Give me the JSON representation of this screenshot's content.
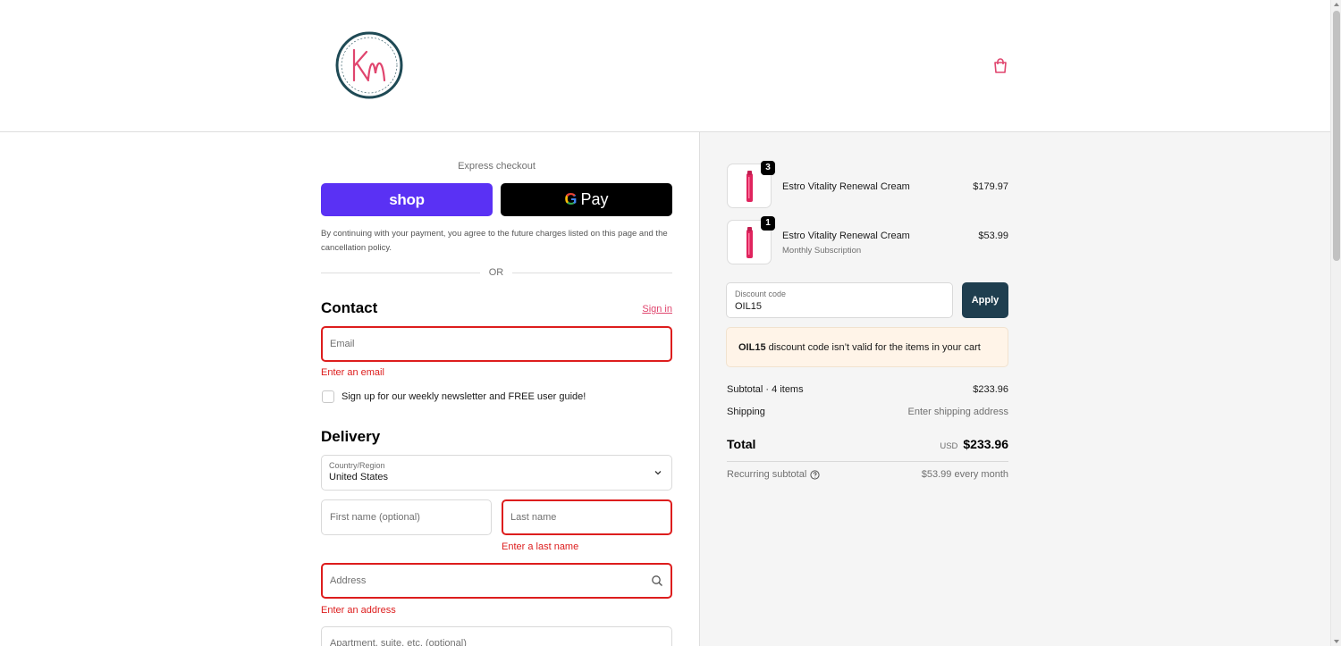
{
  "header": {
    "logo_text": "KM",
    "logo_ring_text": "KAREN MARTEL · HORMONE SOLUTIONS",
    "cart_icon": "shopping-bag-icon"
  },
  "express": {
    "label": "Express checkout",
    "shop_label": "shop",
    "gpay_g": "G",
    "gpay_label": "Pay",
    "agree_text": "By continuing with your payment, you agree to the future charges listed on this page and the cancellation policy.",
    "or_text": "OR"
  },
  "contact": {
    "title": "Contact",
    "signin_label": "Sign in",
    "email_placeholder": "Email",
    "email_error": "Enter an email",
    "newsletter_label": "Sign up for our weekly newsletter and FREE user guide!"
  },
  "delivery": {
    "title": "Delivery",
    "country_label": "Country/Region",
    "country_value": "United States",
    "first_name_placeholder": "First name (optional)",
    "last_name_placeholder": "Last name",
    "last_name_error": "Enter a last name",
    "address_placeholder": "Address",
    "address_error": "Enter an address",
    "apartment_placeholder": "Apartment, suite, etc. (optional)"
  },
  "summary": {
    "items": [
      {
        "name": "Estro Vitality Renewal Cream",
        "subtitle": "",
        "qty": "3",
        "price": "$179.97"
      },
      {
        "name": "Estro Vitality Renewal Cream",
        "subtitle": "Monthly Subscription",
        "qty": "1",
        "price": "$53.99"
      }
    ],
    "discount_label": "Discount code",
    "discount_value": "OIL15",
    "apply_label": "Apply",
    "notice_code": "OIL15",
    "notice_text": "discount code isn’t valid for the items in your cart",
    "subtotal_label": "Subtotal · 4 items",
    "subtotal_value": "$233.96",
    "shipping_label": "Shipping",
    "shipping_value": "Enter shipping address",
    "total_label": "Total",
    "total_currency": "USD",
    "total_value": "$233.96",
    "recurring_label": "Recurring subtotal",
    "recurring_value": "$53.99 every month"
  },
  "colors": {
    "shop_purple": "#5a31f4",
    "error_red": "#dd1d1d",
    "accent_pink": "#e0456e",
    "apply_teal": "#1f3e4f",
    "notice_bg": "#fff4e8"
  }
}
